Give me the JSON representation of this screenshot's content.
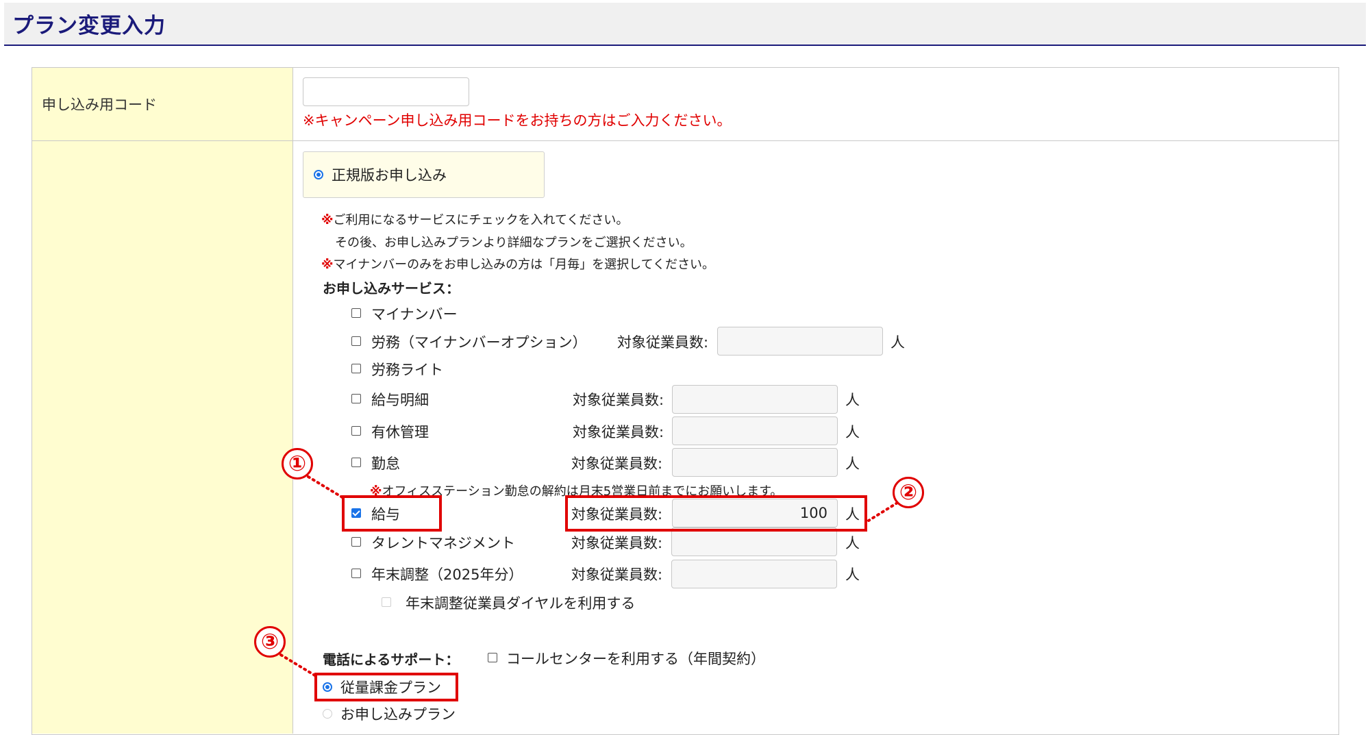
{
  "page": {
    "title": "プラン変更入力"
  },
  "campaign": {
    "label": "申し込み用コード",
    "input_value": "",
    "note": "※キャンペーン申し込み用コードをお持ちの方はご入力ください。"
  },
  "plan": {
    "option_label": "正規版お申し込み",
    "notes": [
      {
        "mark": "※",
        "text": "ご利用になるサービスにチェックを入れてください。"
      },
      {
        "mark": "",
        "text": "その後、お申し込みプランより詳細なプランをご選択ください。"
      },
      {
        "mark": "※",
        "text": "マイナンバーのみをお申し込みの方は「月毎」を選択してください。"
      }
    ],
    "services_heading": "お申し込みサービス：",
    "employee_label": "対象従業員数:",
    "unit": "人",
    "services": [
      {
        "name": "マイナンバー",
        "checked": false
      },
      {
        "name": "労務（マイナンバーオプション）",
        "checked": false,
        "count": ""
      },
      {
        "name": "労務ライト",
        "checked": false
      },
      {
        "name": "給与明細",
        "checked": false,
        "count": ""
      },
      {
        "name": "有休管理",
        "checked": false,
        "count": ""
      },
      {
        "name": "勤怠",
        "checked": false,
        "count": ""
      },
      {
        "name": "給与",
        "checked": true,
        "count": "100"
      },
      {
        "name": "タレントマネジメント",
        "checked": false,
        "count": ""
      },
      {
        "name": "年末調整（2025年分）",
        "checked": false,
        "count": ""
      }
    ],
    "kintai_note_mark": "※",
    "kintai_note": "オフィスステーション勤怠の解約は月末5営業日前までにお願いします。",
    "nenmatsu_dial": "年末調整従業員ダイヤルを利用する",
    "support_heading": "電話によるサポート：",
    "callcenter": "コールセンターを利用する（年間契約）",
    "billing_options": [
      {
        "label": "従量課金プラン",
        "selected": true
      },
      {
        "label": "お申し込みプラン",
        "selected": false
      }
    ]
  },
  "annotations": [
    "①",
    "②",
    "③"
  ],
  "colors": {
    "accent": "#1a1a7a",
    "highlight": "#e00000",
    "label_bg": "#fffdd0",
    "radio": "#1a73e8"
  }
}
